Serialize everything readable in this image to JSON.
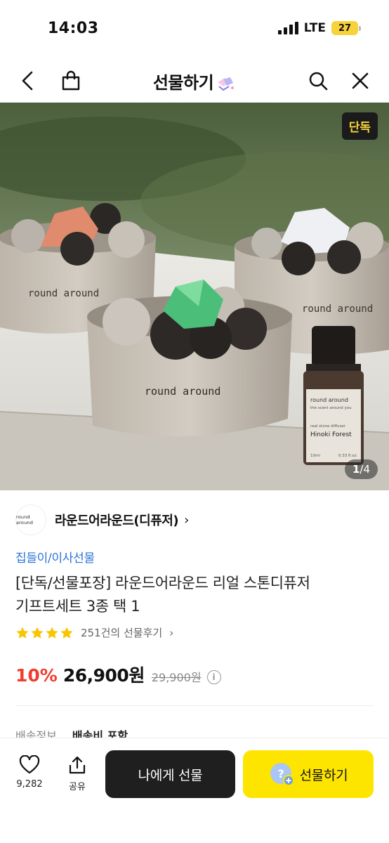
{
  "status": {
    "time": "14:03",
    "network": "LTE",
    "battery": "27"
  },
  "nav": {
    "title": "선물하기"
  },
  "hero": {
    "badge": "단독",
    "page_current": "1",
    "page_sep": "/",
    "page_total": "4",
    "label_diffuser": "round around",
    "bottle_line1": "round around",
    "bottle_line2": "the scent around you",
    "bottle_line3": "real stone diffuser",
    "bottle_line4": "Hinoki Forest",
    "bottle_line5": "10ml",
    "bottle_line6": "0.33 fl.oz."
  },
  "brand": {
    "logo_text": "round around",
    "name": "라운드어라운드(디퓨저)",
    "chevron": "›"
  },
  "product": {
    "category": "집들이/이사선물",
    "title_line1": "[단독/선물포장] 라운드어라운드 리얼 스톤디퓨저",
    "title_line2": "기프트세트 3종 택 1",
    "stars": 4,
    "review_text": "251건의 선물후기",
    "review_chevron": "›",
    "discount": "10%",
    "price": "26,900원",
    "original_price": "29,900원",
    "info_glyph": "i"
  },
  "shipping": {
    "label": "배송정보",
    "value": "배송비 포함"
  },
  "bottom": {
    "like_count": "9,282",
    "share_label": "공유",
    "self_button": "나에게 선물",
    "gift_button": "선물하기"
  },
  "colors": {
    "accent_yellow": "#fee500",
    "discount_red": "#ef3d2f",
    "link_blue": "#2a74d6",
    "star": "#f7c600"
  }
}
